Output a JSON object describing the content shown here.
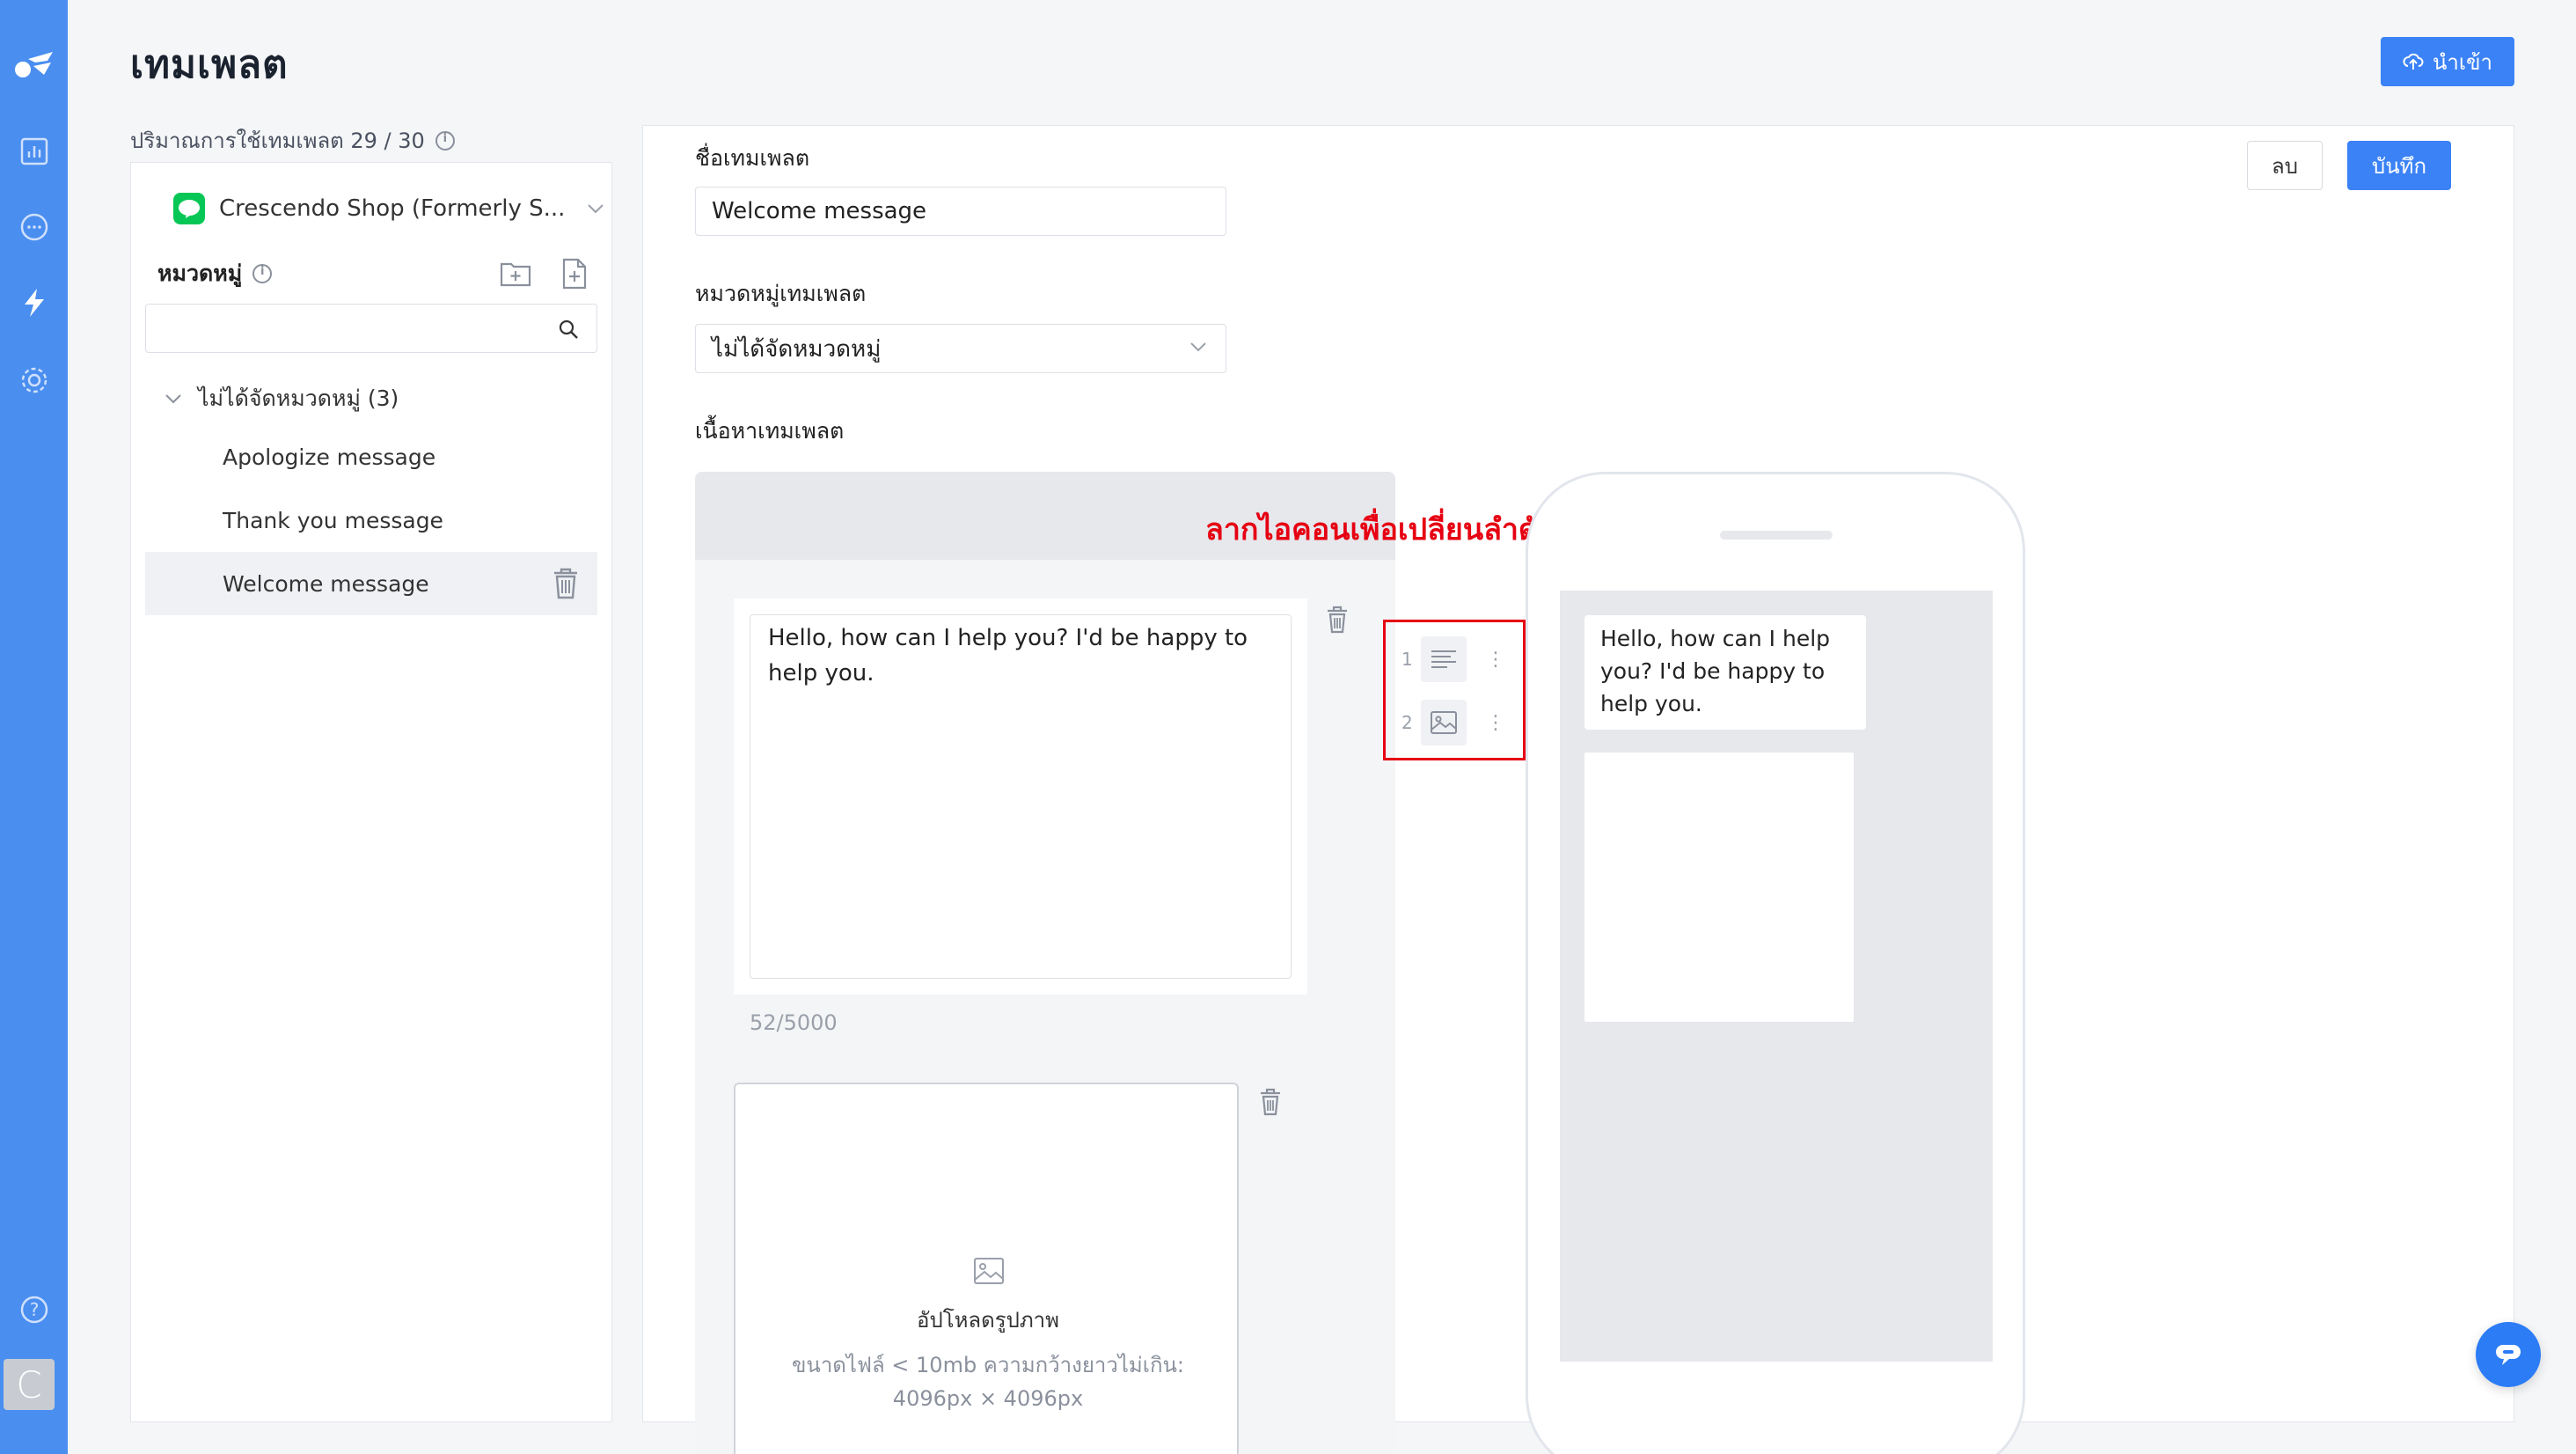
{
  "page": {
    "title": "เทมเพลต",
    "import_label": "นำเข้า",
    "usage_label": "ปริมาณการใช้เทมเพลต 29 / 30"
  },
  "sidebar": {
    "account_name": "Crescendo Shop (Formerly S...",
    "category_label": "หมวดหมู่",
    "search_placeholder": "",
    "group": {
      "label": "ไม่ได้จัดหมวดหมู่ (3)",
      "items": [
        {
          "label": "Apologize message"
        },
        {
          "label": "Thank you message"
        },
        {
          "label": "Welcome message"
        }
      ]
    }
  },
  "editor": {
    "delete_label": "ลบ",
    "save_label": "บันทึก",
    "name_label": "ชื่อเทมเพลต",
    "name_value": "Welcome message",
    "category_label": "หมวดหมู่เทมเพลต",
    "category_value": "ไม่ได้จัดหมวดหมู่",
    "content_label": "เนื้อหาเทมเพลต",
    "text_module": {
      "value": "Hello, how can I help you? I'd be happy to help you.",
      "counter": "52/5000"
    },
    "image_module": {
      "upload_label": "อัปโหลดรูปภาพ",
      "hint": "ขนาดไฟล์ < 10mb  ความกว้างยาวไม่เกิน: 4096px × 4096px"
    },
    "modules": [
      {
        "number": "1",
        "icon": "text-lines-icon"
      },
      {
        "number": "2",
        "icon": "image-icon"
      }
    ]
  },
  "annotation": "ลากไอคอนเพื่อเปลี่ยนลำดับของโมดูล",
  "preview": {
    "bubble_text": "Hello, how can I help you? I'd be happy to help you."
  },
  "colors": {
    "primary": "#3b82f6",
    "rail": "#4a8ef0",
    "annotation": "#e60012",
    "line_green": "#06c755"
  }
}
